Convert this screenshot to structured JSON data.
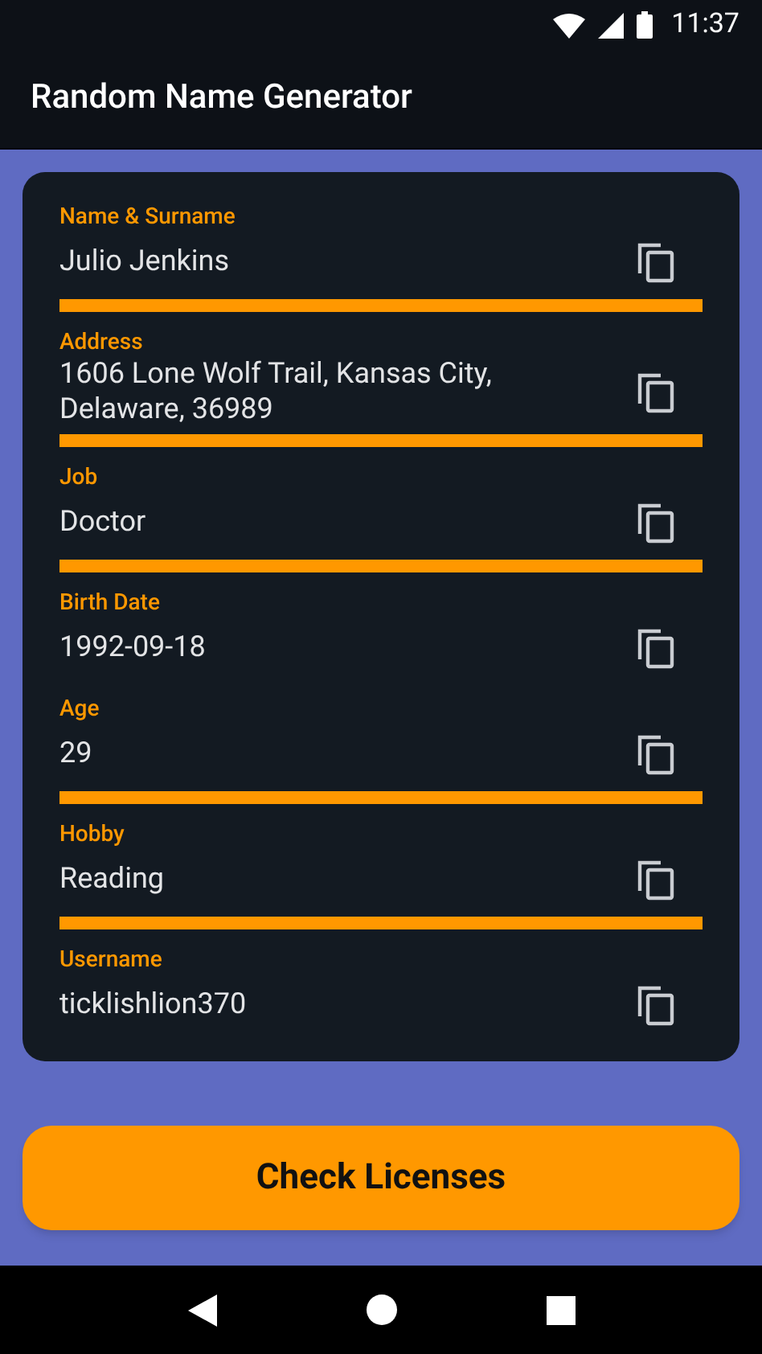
{
  "status_bar": {
    "time": "11:37"
  },
  "app_bar": {
    "title": "Random Name Generator"
  },
  "fields": [
    {
      "label": "Name & Surname",
      "value": "Julio Jenkins",
      "divider": true
    },
    {
      "label": "Address",
      "value": "1606 Lone Wolf Trail, Kansas City, Delaware, 36989",
      "divider": true
    },
    {
      "label": "Job",
      "value": "Doctor",
      "divider": true
    },
    {
      "label": "Birth Date",
      "value": "1992-09-18",
      "divider": false
    },
    {
      "label": "Age",
      "value": "29",
      "divider": true
    },
    {
      "label": "Hobby",
      "value": "Reading",
      "divider": true
    },
    {
      "label": "Username",
      "value": "ticklishlion370",
      "divider": false
    }
  ],
  "button": {
    "label": "Check Licenses"
  }
}
